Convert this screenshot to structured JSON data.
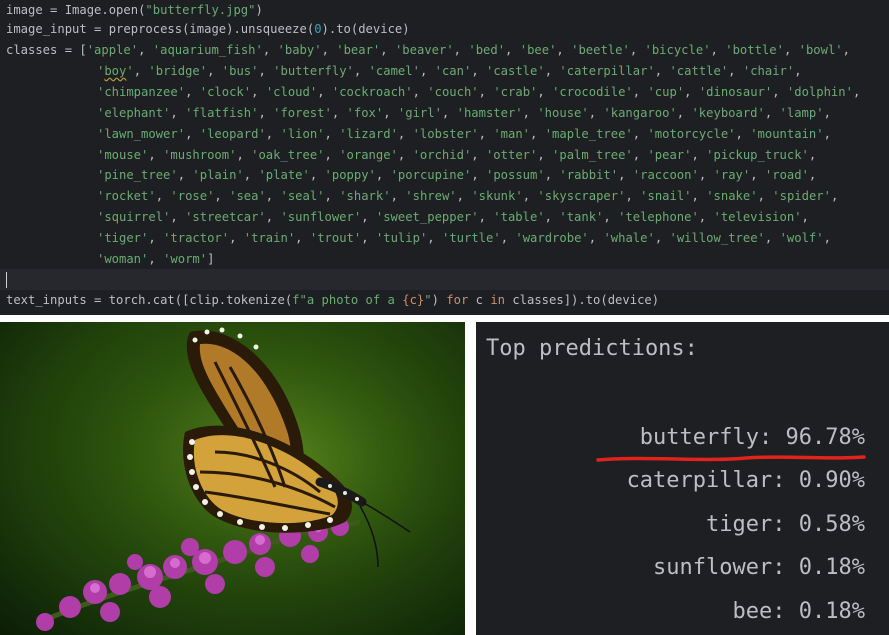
{
  "editor": {
    "line1": {
      "pre": "image = Image.open(",
      "str": "\"butterfly.jpg\"",
      "post": ")"
    },
    "line2": {
      "pre": "image_input = preprocess(image).unsqueeze(",
      "num": "0",
      "post": ").to(device)"
    },
    "classes_prefix": "classes = [",
    "class_rows": [
      [
        "apple",
        "aquarium_fish",
        "baby",
        "bear",
        "beaver",
        "bed",
        "bee",
        "beetle",
        "bicycle",
        "bottle",
        "bowl"
      ],
      [
        "boy",
        "bridge",
        "bus",
        "butterfly",
        "camel",
        "can",
        "castle",
        "caterpillar",
        "cattle",
        "chair"
      ],
      [
        "chimpanzee",
        "clock",
        "cloud",
        "cockroach",
        "couch",
        "crab",
        "crocodile",
        "cup",
        "dinosaur",
        "dolphin"
      ],
      [
        "elephant",
        "flatfish",
        "forest",
        "fox",
        "girl",
        "hamster",
        "house",
        "kangaroo",
        "keyboard",
        "lamp"
      ],
      [
        "lawn_mower",
        "leopard",
        "lion",
        "lizard",
        "lobster",
        "man",
        "maple_tree",
        "motorcycle",
        "mountain"
      ],
      [
        "mouse",
        "mushroom",
        "oak_tree",
        "orange",
        "orchid",
        "otter",
        "palm_tree",
        "pear",
        "pickup_truck"
      ],
      [
        "pine_tree",
        "plain",
        "plate",
        "poppy",
        "porcupine",
        "possum",
        "rabbit",
        "raccoon",
        "ray",
        "road"
      ],
      [
        "rocket",
        "rose",
        "sea",
        "seal",
        "shark",
        "shrew",
        "skunk",
        "skyscraper",
        "snail",
        "snake",
        "spider"
      ],
      [
        "squirrel",
        "streetcar",
        "sunflower",
        "sweet_pepper",
        "table",
        "tank",
        "telephone",
        "television"
      ],
      [
        "tiger",
        "tractor",
        "train",
        "trout",
        "tulip",
        "turtle",
        "wardrobe",
        "whale",
        "willow_tree",
        "wolf"
      ],
      [
        "woman",
        "worm"
      ]
    ],
    "last_line": {
      "pre": "text_inputs = torch.cat([clip.tokenize(",
      "fstr_a": "f\"a photo of a ",
      "fvar": "{c}",
      "fstr_b": "\"",
      "mid1": ") ",
      "kw_for": "for",
      "mid2": " c ",
      "kw_in": "in",
      "post": " classes]).to(device)"
    }
  },
  "predictions": {
    "title": "Top predictions:",
    "items": [
      {
        "label": "butterfly",
        "value": "96.78%"
      },
      {
        "label": "caterpillar",
        "value": "0.90%"
      },
      {
        "label": "tiger",
        "value": "0.58%"
      },
      {
        "label": "sunflower",
        "value": "0.18%"
      },
      {
        "label": "bee",
        "value": "0.18%"
      }
    ],
    "highlight_color": "#e0231b"
  },
  "colors": {
    "editor_bg": "#1e1f22",
    "string": "#6aab73",
    "keyword": "#cf8e6d",
    "number": "#2aacb8",
    "text": "#bcbec4"
  }
}
